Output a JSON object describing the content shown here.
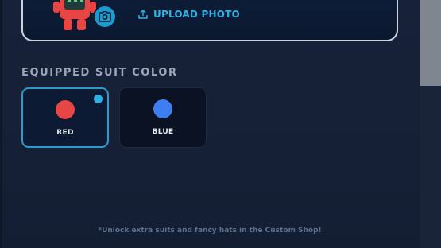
{
  "profile": {
    "upload_label": "UPLOAD PHOTO",
    "avatar_icon": "robot-avatar-icon",
    "camera_icon": "camera-icon",
    "upload_icon": "upload-icon"
  },
  "suit_section": {
    "heading": "EQUIPPED SUIT COLOR",
    "options": [
      {
        "label": "RED",
        "color": "#e84545",
        "selected": true
      },
      {
        "label": "BLUE",
        "color": "#3d7ef0",
        "selected": false
      }
    ]
  },
  "footnote": "*Unlock extra suits and fancy hats in the Custom Shop!",
  "colors": {
    "accent": "#2fb1e6",
    "background": "#152036"
  }
}
